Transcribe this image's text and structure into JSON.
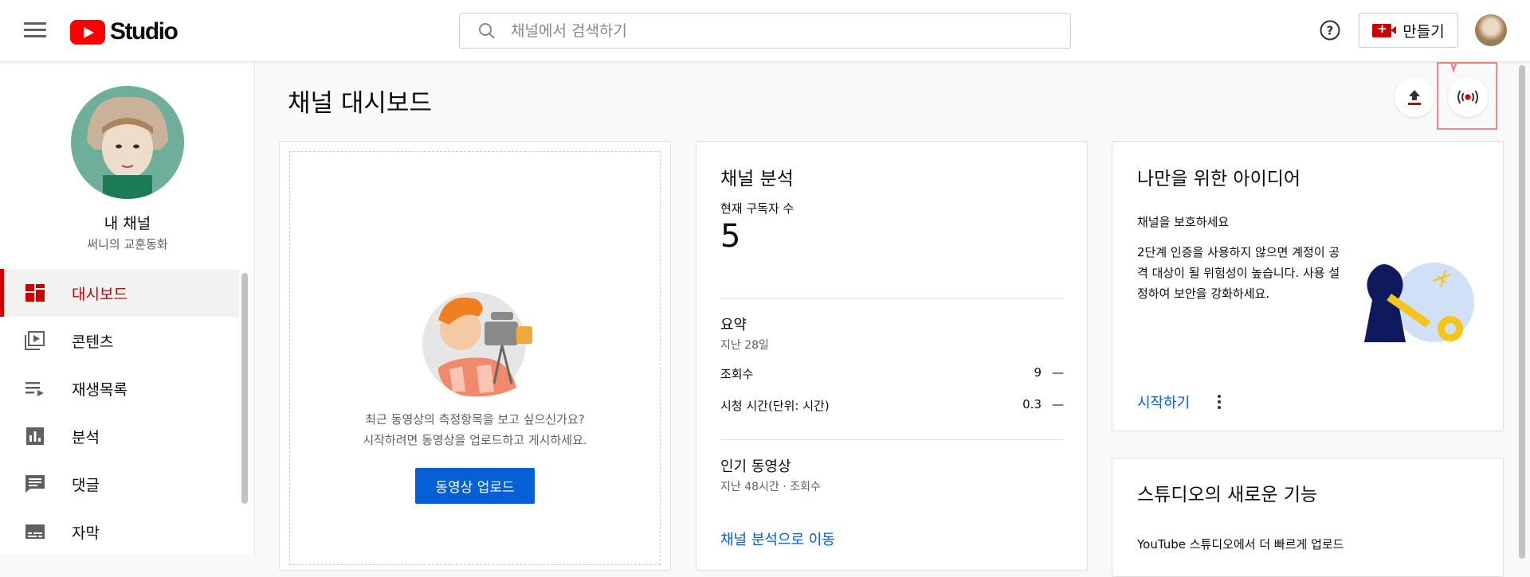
{
  "app": {
    "logo_text": "Studio"
  },
  "search": {
    "placeholder": "채널에서 검색하기"
  },
  "header": {
    "create_label": "만들기"
  },
  "sidebar": {
    "channel_label": "내 채널",
    "channel_name": "써니의 교훈동화",
    "items": [
      {
        "label": "대시보드",
        "icon": "dashboard-icon",
        "active": true
      },
      {
        "label": "콘텐츠",
        "icon": "video-library-icon",
        "active": false
      },
      {
        "label": "재생목록",
        "icon": "playlist-icon",
        "active": false
      },
      {
        "label": "분석",
        "icon": "analytics-icon",
        "active": false
      },
      {
        "label": "댓글",
        "icon": "comment-icon",
        "active": false
      },
      {
        "label": "자막",
        "icon": "subtitles-icon",
        "active": false
      }
    ]
  },
  "main": {
    "title": "채널 대시보드",
    "upload_card": {
      "line1": "최근 동영상의 측정항목을 보고 싶으신가요?",
      "line2": "시작하려면 동영상을 업로드하고 게시하세요.",
      "button": "동영상 업로드"
    },
    "analytics": {
      "title": "채널 분석",
      "subs_label": "현재 구독자 수",
      "subs_value": "5",
      "summary_title": "요약",
      "summary_period": "지난 28일",
      "rows": [
        {
          "label": "조회수",
          "value": "9",
          "trend": "—"
        },
        {
          "label": "시청 시간(단위: 시간)",
          "value": "0.3",
          "trend": "—"
        }
      ],
      "top_videos_title": "인기 동영상",
      "top_videos_sub": "지난 48시간 · 조회수",
      "link": "채널 분석으로 이동"
    },
    "ideas": {
      "title": "나만을 위한 아이디어",
      "subtitle": "채널을 보호하세요",
      "body": "2단계 인증을 사용하지 않으면 계정이 공격 대상이 될 위험성이 높습니다. 사용 설정하여 보안을 강화하세요.",
      "link": "시작하기"
    },
    "whats_new": {
      "title": "스튜디오의 새로운 기능",
      "item1": "YouTube 스튜디오에서 더 빠르게 업로드"
    }
  },
  "colors": {
    "accent_red": "#cc0000",
    "link_blue": "#065fd4",
    "annotation": "#f08a8a"
  }
}
